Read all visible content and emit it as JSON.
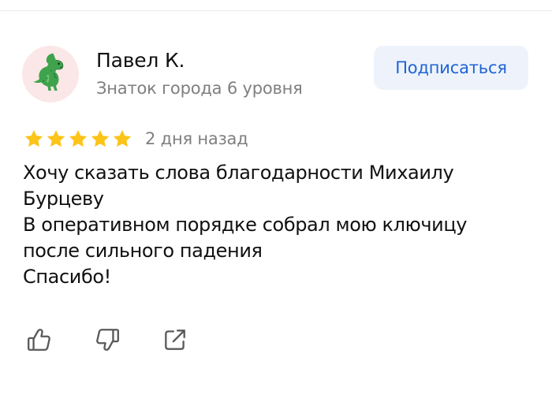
{
  "review": {
    "author": {
      "name": "Павел К.",
      "level": "Знаток города 6 уровня",
      "avatar": "dinosaur-emoji"
    },
    "subscribe_label": "Подписаться",
    "rating": {
      "stars": 5,
      "max": 5
    },
    "date": "2 дня назад",
    "text_lines": [
      "Хочу сказать слова благодарности Михаилу",
      "Бурцеву",
      "В оперативном порядке собрал мою ключицу",
      "после сильного падения",
      "Спасибо!"
    ],
    "actions": [
      {
        "icon": "thumbs-up-icon"
      },
      {
        "icon": "thumbs-down-icon"
      },
      {
        "icon": "share-icon"
      }
    ]
  },
  "colors": {
    "accent": "#1f63d6",
    "subscribe_bg": "#eef3fb",
    "star": "#fcc419",
    "secondary_text": "#7f7f7f",
    "avatar_bg": "#fbe7e7"
  }
}
